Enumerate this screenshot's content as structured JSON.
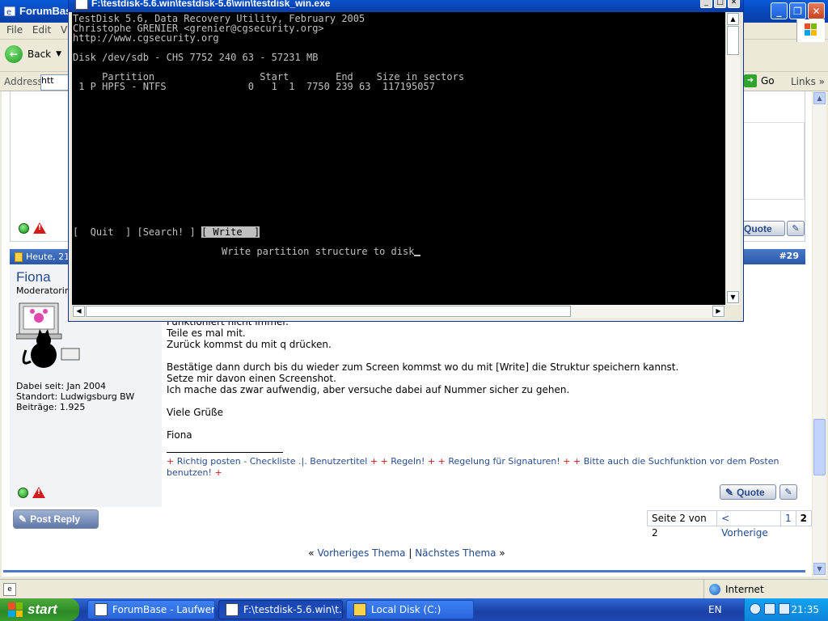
{
  "browser": {
    "title": "ForumBas",
    "menu": [
      "File",
      "Edit",
      "Vi"
    ],
    "back_label": "Back",
    "address_label": "Address",
    "address_value": "htt",
    "go_label": "Go",
    "links_label": "Links",
    "status_zone": "Internet"
  },
  "console": {
    "title": "F:\\testdisk-5.6.win\\testdisk-5.6\\win\\testdisk_win.exe",
    "lines": [
      "TestDisk 5.6, Data Recovery Utility, February 2005",
      "Christophe GRENIER <grenier@cgsecurity.org>",
      "http://www.cgsecurity.org",
      "",
      "Disk /dev/sdb - CHS 7752 240 63 - 57231 MB",
      "",
      "     Partition                  Start        End    Size in sectors",
      " 1 P HPFS - NTFS              0   1  1  7750 239 63  117195057"
    ],
    "menu_quit": "[  Quit  ]",
    "menu_search": "[Search! ]",
    "menu_write": "[ Write  ]",
    "prompt": "Write partition structure to disk"
  },
  "post": {
    "date": "Heute, 21",
    "number": "#29",
    "author": "Fiona",
    "role": "Moderatorin",
    "member_since": "Dabei seit: Jan 2004",
    "location": "Standort: Ludwigsburg BW",
    "posts": "Beiträge: 1.925",
    "body_lines": [
      "Funktioniert nicht immer.",
      "Teile es mal mit.",
      "Zurück kommst du mit q drücken.",
      "",
      "Bestätige dann durch bis du wieder zum Screen kommst wo du mit [Write] die Struktur speichern kannst.",
      "Setze mir davon einen Screenshot.",
      "Ich mache das zwar aufwendig, aber versuche dabei auf Nummer sicher zu gehen.",
      "",
      "Viele Grüße",
      "",
      "Fiona"
    ],
    "signature": [
      {
        "text": "Richtig posten - Checkliste .|. Benutzertitel"
      },
      {
        "text": "Regeln!"
      },
      {
        "text": "Regelung für Signaturen!"
      },
      {
        "text": "Bitte auch die Suchfunktion vor dem Posten benutzen!"
      }
    ],
    "quote_label": "Quote"
  },
  "footer": {
    "post_reply": "Post Reply",
    "pager_label": "Seite 2 von 2",
    "pager_prev": "< Vorherige",
    "pager_p1": "1",
    "pager_p2": "2",
    "prev_thread": "Vorheriges Thema",
    "next_thread": "Nächstes Thema",
    "sep": "|",
    "laquo": "«",
    "raquo": "»"
  },
  "taskbar": {
    "start": "start",
    "tasks": [
      "ForumBase - Laufwer...",
      "F:\\testdisk-5.6.win\\t...",
      "Local Disk (C:)"
    ],
    "lang": "EN",
    "clock": "21:35"
  }
}
